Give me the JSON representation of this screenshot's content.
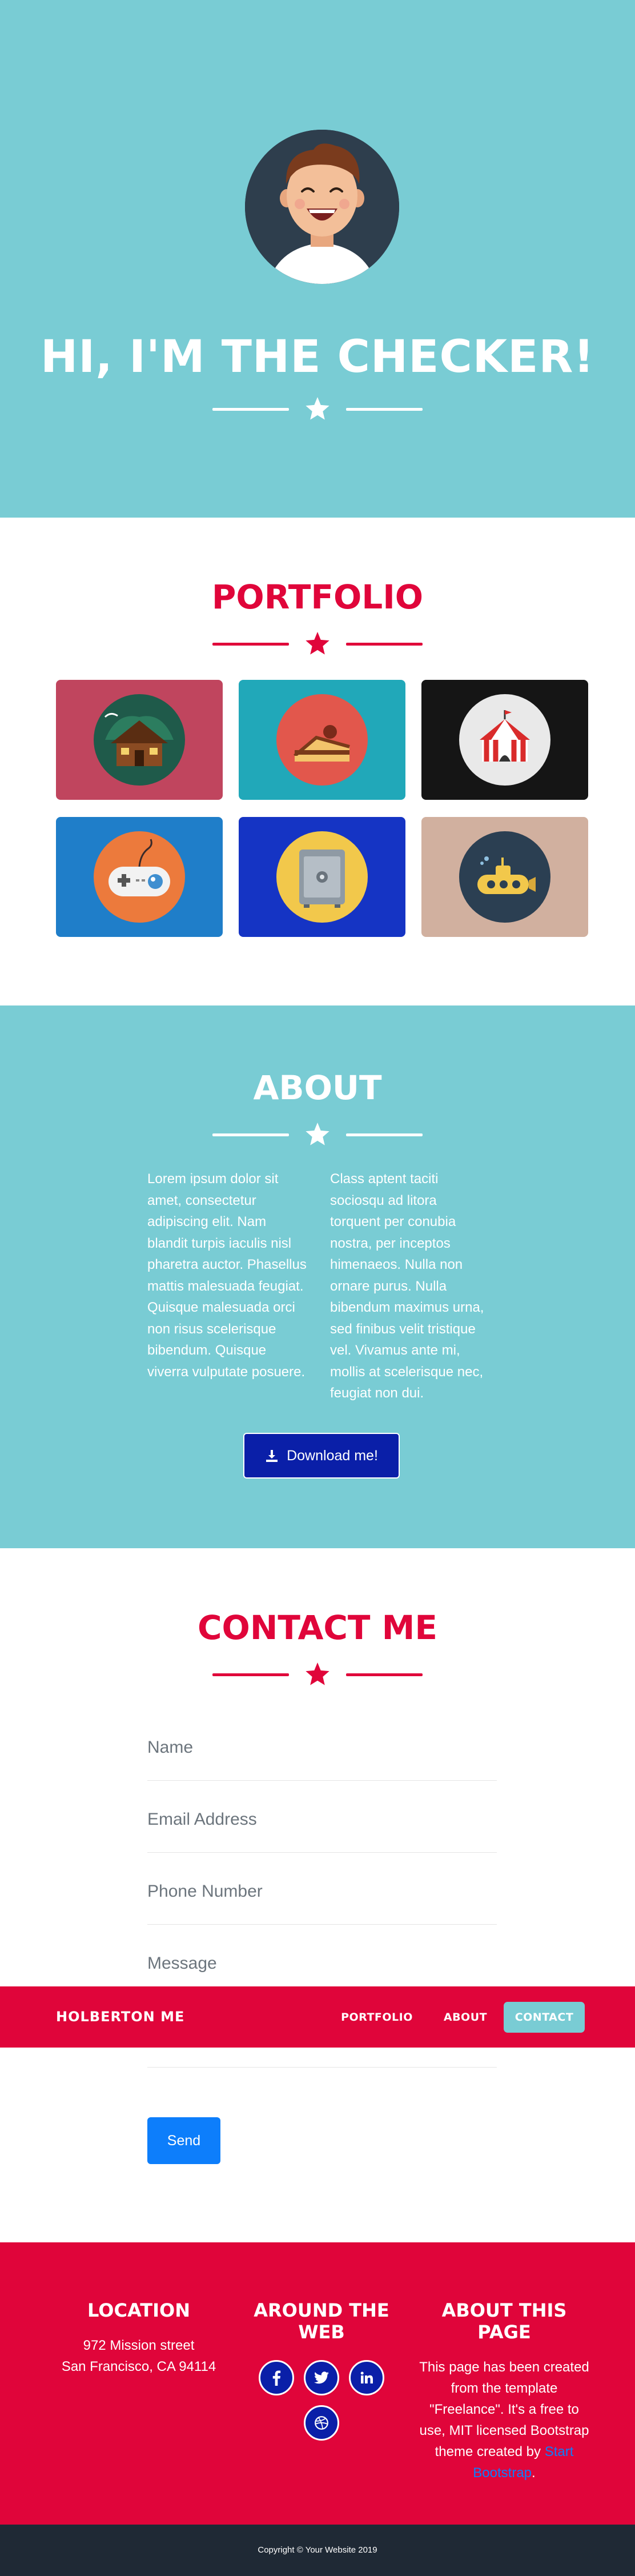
{
  "hero": {
    "title": "HI, I'M THE CHECKER!",
    "avatar_icon": "avatar-boy-laughing-icon",
    "star_icon": "star-icon"
  },
  "portfolio": {
    "title": "PORTFOLIO",
    "items": [
      {
        "icon": "cabin-icon",
        "background": "#c0455e"
      },
      {
        "icon": "cake-icon",
        "background": "#21a8b9"
      },
      {
        "icon": "circus-tent-icon",
        "background": "#151515"
      },
      {
        "icon": "game-controller-icon",
        "background": "#1f7ec9"
      },
      {
        "icon": "safe-icon",
        "background": "#1534c4"
      },
      {
        "icon": "submarine-icon",
        "background": "#d1b09f"
      }
    ]
  },
  "about": {
    "title": "ABOUT",
    "left_text": "Lorem ipsum dolor sit amet, consectetur adipiscing elit. Nam blandit turpis iaculis nisl pharetra auctor. Phasellus mattis malesuada feugiat. Quisque malesuada orci non risus scelerisque bibendum. Quisque viverra vulputate posuere.",
    "right_text": "Class aptent taciti sociosqu ad litora torquent per conubia nostra, per inceptos himenaeos. Nulla non ornare purus. Nulla bibendum maximus urna, sed finibus velit tristique vel. Vivamus ante mi, mollis at scelerisque nec, feugiat non dui.",
    "download_label": "Download me!",
    "download_icon": "download-icon"
  },
  "contact": {
    "title": "CONTACT ME",
    "fields": {
      "name_placeholder": "Name",
      "email_placeholder": "Email Address",
      "phone_placeholder": "Phone Number",
      "message_placeholder": "Message"
    },
    "send_label": "Send"
  },
  "navbar": {
    "brand": "HOLBERTON ME",
    "links": [
      "PORTFOLIO",
      "ABOUT",
      "CONTACT"
    ],
    "active": "CONTACT"
  },
  "footer": {
    "location": {
      "title": "LOCATION",
      "line1": "972 Mission street",
      "line2": "San Francisco, CA 94114"
    },
    "web": {
      "title": "AROUND THE WEB",
      "icons": [
        "facebook-icon",
        "twitter-icon",
        "linkedin-icon",
        "dribbble-icon"
      ]
    },
    "about_page": {
      "title": "ABOUT THIS PAGE",
      "text": "This page has been created from the template \"Freelance\". It's a free to use, MIT licensed Bootstrap theme created by",
      "link": "Start Bootstrap",
      "suffix": "."
    }
  },
  "copyright": "Copyright © Your Website 2019",
  "colors": {
    "teal": "#79ccd4",
    "crimson": "#e0053a",
    "navy": "#0a1fa8",
    "blue": "#0d7efb",
    "dark": "#1f2935"
  }
}
